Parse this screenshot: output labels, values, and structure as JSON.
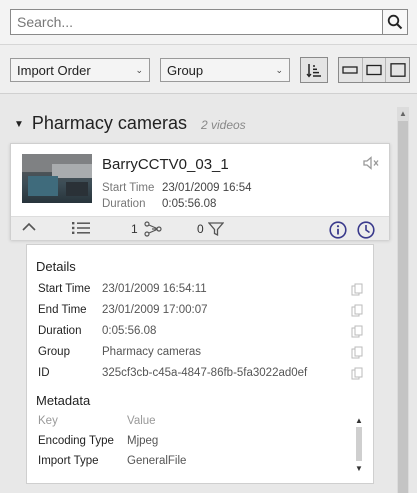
{
  "search": {
    "placeholder": "Search..."
  },
  "toolbar": {
    "order_select": "Import Order",
    "group_select": "Group"
  },
  "group": {
    "title": "Pharmacy cameras",
    "count": "2 videos"
  },
  "video": {
    "title": "BarryCCTV0_03_1",
    "start_time_label": "Start Time",
    "start_time": "23/01/2009 16:54",
    "duration_label": "Duration",
    "duration": "0:05:56.08",
    "tracks_count": "1",
    "filters_count": "0"
  },
  "details": {
    "title": "Details",
    "rows": [
      {
        "label": "Start Time",
        "value": "23/01/2009 16:54:11"
      },
      {
        "label": "End Time",
        "value": "23/01/2009 17:00:07"
      },
      {
        "label": "Duration",
        "value": "0:05:56.08"
      },
      {
        "label": "Group",
        "value": "Pharmacy cameras"
      },
      {
        "label": "ID",
        "value": "325cf3cb-c45a-4847-86fb-5fa3022ad0ef"
      }
    ]
  },
  "metadata": {
    "title": "Metadata",
    "header": {
      "key": "Key",
      "value": "Value"
    },
    "rows": [
      {
        "key": "Encoding Type",
        "value": "Mjpeg"
      },
      {
        "key": "Import Type",
        "value": "GeneralFile"
      }
    ]
  },
  "colors": {
    "accent": "#3a3a8c",
    "background": "#e8e8e8",
    "card": "#ffffff"
  }
}
